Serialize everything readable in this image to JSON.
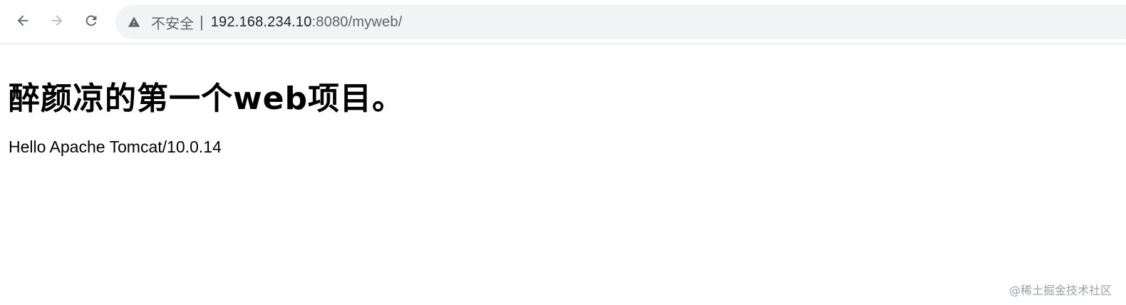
{
  "browser": {
    "nav": {
      "back_icon": "arrow-left-icon",
      "forward_icon": "arrow-right-icon",
      "reload_icon": "reload-icon"
    },
    "address_bar": {
      "security_icon": "warning-triangle-icon",
      "security_label": "不安全",
      "separator": "|",
      "url_host": "192.168.234.10",
      "url_rest": ":8080/myweb/"
    }
  },
  "page": {
    "heading": "醉颜凉的第一个web项目。",
    "text": "Hello Apache Tomcat/10.0.14"
  },
  "watermark": "@稀土掘金技术社区",
  "colors": {
    "toolbar_bg": "#ffffff",
    "omnibox_bg": "#f1f3f4",
    "secondary_text": "#5f6368",
    "disabled_icon": "#9aa0a6"
  }
}
